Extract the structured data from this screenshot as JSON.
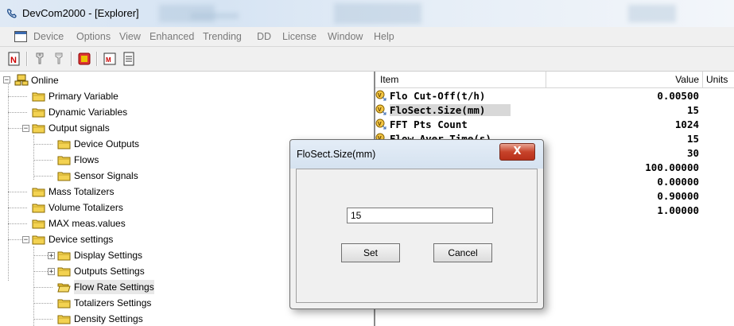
{
  "window": {
    "title": "DevCom2000 - [Explorer]"
  },
  "menu": [
    "Device",
    "Options",
    "View",
    "Enhanced",
    "Trending",
    "DD",
    "License",
    "Window",
    "Help"
  ],
  "toolbar": {
    "icons": [
      "device-connect-icon",
      "probe-icon",
      "probe-alt-icon",
      "stop-icon",
      "data-view-icon",
      "document-icon"
    ]
  },
  "tree": {
    "root": "Online",
    "items": [
      "Primary Variable",
      "Dynamic Variables",
      "Output signals",
      "Device Outputs",
      "Flows",
      "Sensor Signals",
      "Mass Totalizers",
      "Volume Totalizers",
      "MAX meas.values",
      "Device settings",
      "Display Settings",
      "Outputs Settings",
      "Flow Rate Settings",
      "Totalizers Settings",
      "Density Settings"
    ]
  },
  "list": {
    "columns": {
      "item": "Item",
      "value": "Value",
      "units": "Units"
    },
    "rows": [
      {
        "name": "Flo Cut-Off(t/h)",
        "value": "0.00500"
      },
      {
        "name": "FloSect.Size(mm)",
        "value": "15"
      },
      {
        "name": "FFT Pts Count",
        "value": "1024"
      },
      {
        "name": "Flow Aver.Time(s)",
        "value": "15"
      },
      {
        "name": "",
        "value": "30"
      },
      {
        "name": "",
        "value": "100.00000"
      },
      {
        "name": "",
        "value": "0.00000"
      },
      {
        "name": "",
        "value": "0.90000"
      },
      {
        "name": "",
        "value": "1.00000"
      }
    ]
  },
  "dialog": {
    "title": "FloSect.Size(mm)",
    "close_label": "X",
    "input_value": "15",
    "set_label": "Set",
    "cancel_label": "Cancel"
  }
}
